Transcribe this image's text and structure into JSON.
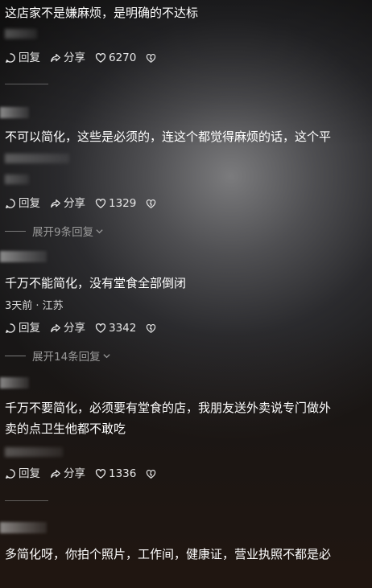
{
  "comments": [
    {
      "text": "这店家不是嫌麻烦，是明确的不达标",
      "reply_label": "回复",
      "share_label": "分享",
      "likes": "6270"
    },
    {
      "text": "不可以简化，这些是必须的，连这个都觉得麻烦的话，这个平",
      "reply_label": "回复",
      "share_label": "分享",
      "likes": "1329",
      "expand_label": "展开9条回复"
    },
    {
      "text": "千万不能简化，没有堂食全部倒闭",
      "meta": "3天前 · 江苏",
      "reply_label": "回复",
      "share_label": "分享",
      "likes": "3342",
      "expand_label": "展开14条回复"
    },
    {
      "text_line1": "千万不要简化，必须要有堂食的店，我朋友送外卖说专门做外",
      "text_line2": "卖的点卫生他都不敢吃",
      "reply_label": "回复",
      "share_label": "分享",
      "likes": "1336"
    },
    {
      "text": "多简化呀，你拍个照片，工作间，健康证，营业执照不都是必"
    }
  ]
}
